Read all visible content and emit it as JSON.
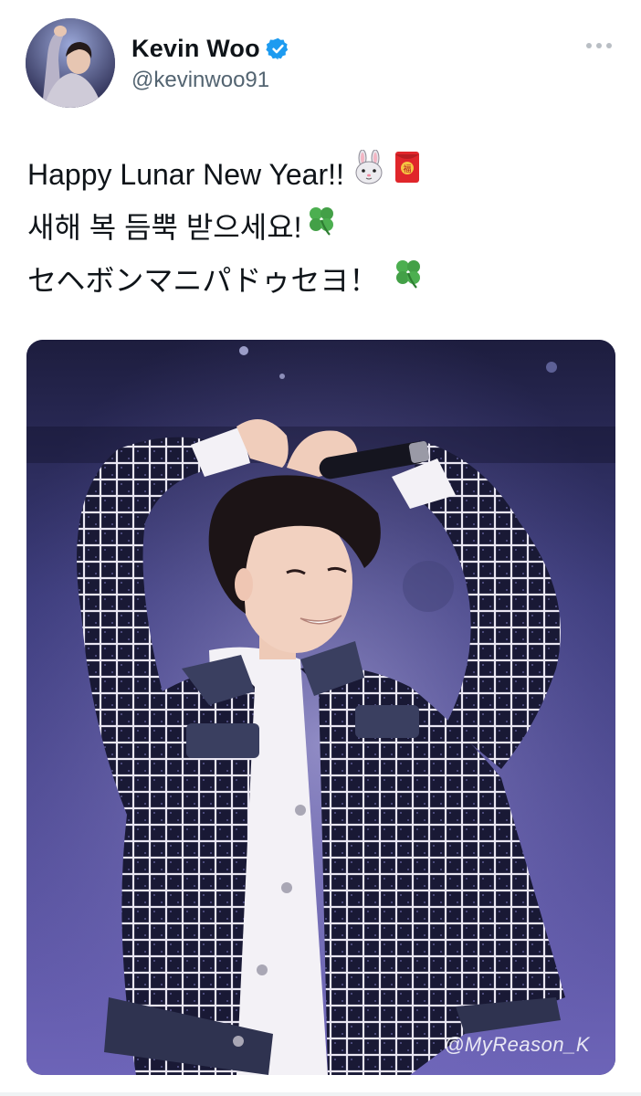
{
  "user": {
    "display_name": "Kevin Woo",
    "handle": "@kevinwoo91",
    "verified": true
  },
  "tweet": {
    "lines": [
      "Happy Lunar New Year!!",
      "새해 복 듬뿍 받으세요!",
      "セヘボンマニパドゥセヨ！"
    ],
    "emojis": [
      "rabbit-face-emoji",
      "red-envelope-emoji",
      "four-leaf-clover-emoji"
    ]
  },
  "media": {
    "watermark": "@MyReason_K"
  },
  "colors": {
    "text": "#0f1419",
    "secondary": "#536471",
    "verified_blue": "#1d9bf0",
    "divider": "#eff3f4"
  }
}
